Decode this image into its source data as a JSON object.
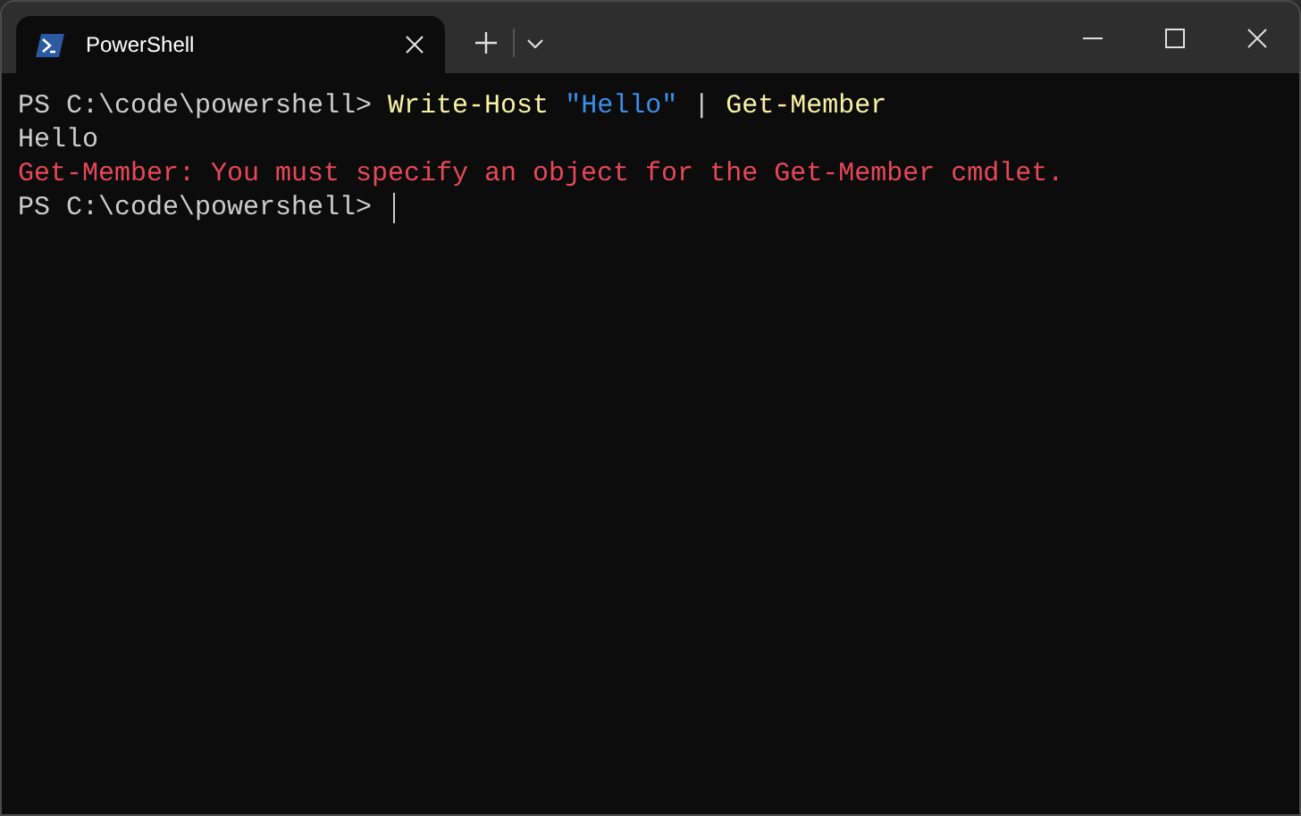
{
  "tabs": [
    {
      "title": "PowerShell",
      "selected": true
    }
  ],
  "terminal": {
    "lines": [
      [
        {
          "kind": "prompt",
          "text": "PS C:\\code\\powershell> "
        },
        {
          "kind": "command",
          "text": "Write-Host "
        },
        {
          "kind": "string",
          "text": "\"Hello\""
        },
        {
          "kind": "plain",
          "text": " | "
        },
        {
          "kind": "command",
          "text": "Get-Member"
        }
      ],
      [
        {
          "kind": "plain",
          "text": "Hello"
        }
      ],
      [
        {
          "kind": "error",
          "text": "Get-Member: You must specify an object for the Get-Member cmdlet."
        }
      ],
      [
        {
          "kind": "prompt",
          "text": "PS C:\\code\\powershell> "
        },
        {
          "kind": "cursor"
        }
      ]
    ]
  }
}
